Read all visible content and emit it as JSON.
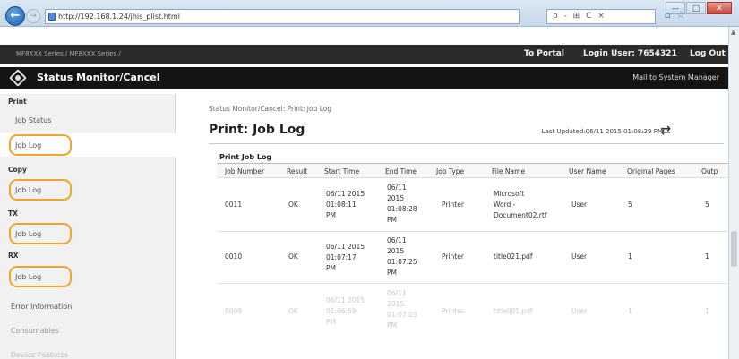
{
  "browser": {
    "url": "http://192.168.1.24/jhis_plist.html",
    "search_placeholder": "ρ - ⊞ C ×",
    "window_controls": {
      "minimize": "—",
      "maximize": "□",
      "close": "✕"
    },
    "icons": {
      "back": "←",
      "forward": "→",
      "home": "⌂",
      "favorites": "☆"
    }
  },
  "header": {
    "device": "MF8XXX Series / MF8XXX Series /",
    "to_portal": "To Portal",
    "login_user": "Login User: 7654321",
    "logout": "Log Out"
  },
  "subheader": {
    "title": "Status Monitor/Cancel",
    "mail_link": "Mail to System Manager"
  },
  "sidebar": {
    "sections": [
      {
        "title": "Print",
        "items": [
          "Job Status",
          "Job Log"
        ]
      },
      {
        "title": "Copy",
        "items": [
          "Job Log"
        ]
      },
      {
        "title": "TX",
        "items": [
          "Job Log"
        ]
      },
      {
        "title": "RX",
        "items": [
          "Job Log"
        ]
      }
    ],
    "more": [
      "Error Information",
      "Consumables",
      "Device Features"
    ]
  },
  "main": {
    "breadcrumb": "Status Monitor/Cancel: Print: Job Log",
    "title": "Print: Job Log",
    "last_updated": "Last Updated:06/11 2015 01:08:29 PM",
    "table_caption": "Print Job Log",
    "columns": [
      "Job Number",
      "Result",
      "Start Time",
      "End Time",
      "Job Type",
      "File Name",
      "User Name",
      "Original Pages",
      "Outp"
    ],
    "rows": [
      {
        "job_number": "0011",
        "result": "OK",
        "start": "06/11 2015\n01:08:11\nPM",
        "end": "06/11\n2015\n01:08:28\nPM",
        "job_type": "Printer",
        "file_name": "Microsoft\nWord -\nDocument02.rtf",
        "user": "User",
        "pages": "5",
        "outp": "5"
      },
      {
        "job_number": "0010",
        "result": "OK",
        "start": "06/11 2015\n01:07:17\nPM",
        "end": "06/11\n2015\n01:07:25\nPM",
        "job_type": "Printer",
        "file_name": "title021.pdf",
        "user": "User",
        "pages": "1",
        "outp": "1"
      },
      {
        "job_number": "0009",
        "result": "OK",
        "start": "06/11 2015\n01:06:59\nPM",
        "end": "06/11\n2015\n01:07:03\nPM",
        "job_type": "Printer",
        "file_name": "title001.pdf",
        "user": "User",
        "pages": "1",
        "outp": "1"
      }
    ]
  },
  "colors": {
    "highlight": "#f2a52c",
    "header_bg": "#2b2b2b",
    "subheader_bg": "#141414"
  }
}
